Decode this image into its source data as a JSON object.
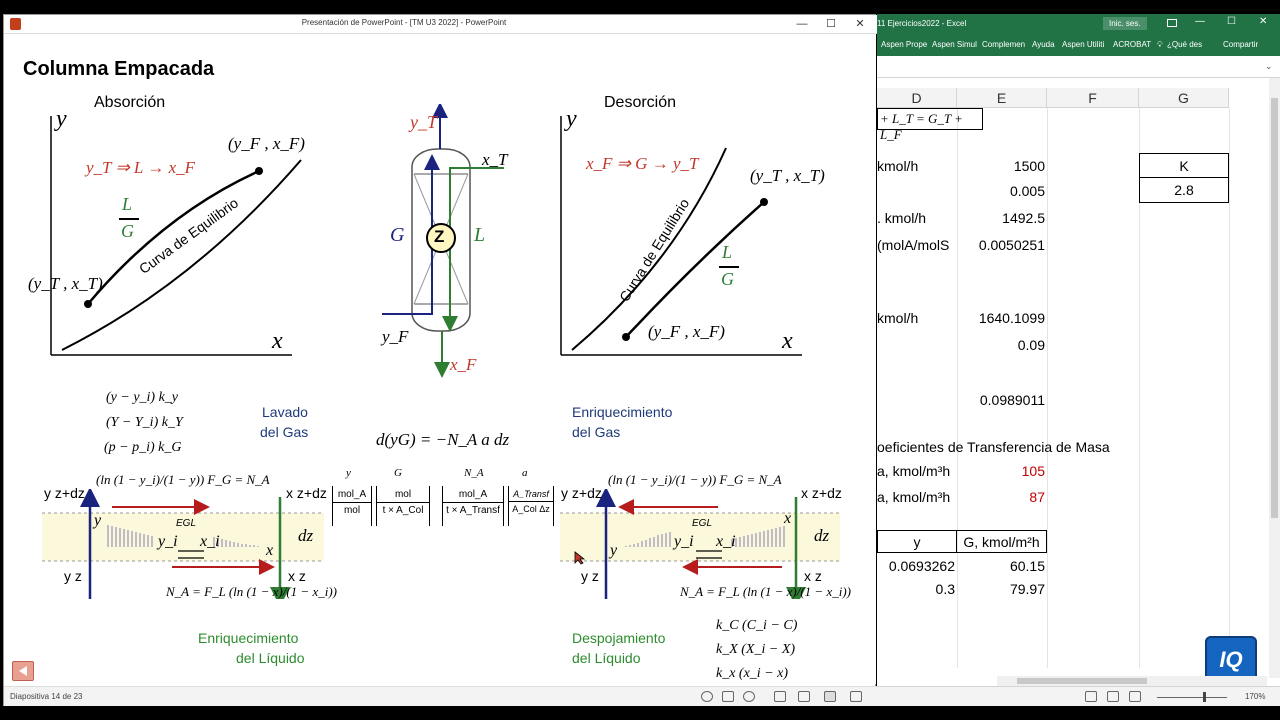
{
  "ppt": {
    "window_title": "Presentación de PowerPoint - [TM U3 2022] - PowerPoint",
    "status_left": "Diapositiva 14 de 23",
    "zoom": "",
    "slide": {
      "title": "Columna Empacada",
      "absorcion": {
        "heading": "Absorción",
        "y_axis": "y",
        "x_axis": "x",
        "flow_eq": "y_T ⇒ L → x_F",
        "top_point": "(y_F , x_F)",
        "bottom_point": "(y_T , x_T)",
        "curve_label": "Curva de Equilibrio",
        "slope_num": "L",
        "slope_den": "G"
      },
      "column": {
        "yT": "y_T",
        "xT": "x_T",
        "G": "G",
        "Z": "Z",
        "L": "L",
        "yF": "y_F",
        "xF": "x_F"
      },
      "desorcion": {
        "heading": "Desorción",
        "y_axis": "y",
        "x_axis": "x",
        "flow_eq": "x_F ⇒ G → y_T",
        "top_point": "(y_T , x_T)",
        "bottom_point": "(y_F , x_F)",
        "curve_label": "Curva de Equilibrio",
        "slope_num": "L",
        "slope_den": "G"
      },
      "left_lower": {
        "driving_forces": [
          "(y − y_i) k_y",
          "(Y − Y_i) k_Y",
          "(p − p_i) k_G"
        ],
        "title_line1": "Lavado",
        "title_line2": "del Gas",
        "flux_gas": "(ln (1 − y_i)/(1 − y)) F_G = N_A",
        "y_top": "y z+dz",
        "y_bottom": "y z",
        "x_top": "x z+dz",
        "x_bottom": "x z",
        "dz": "dz",
        "y": "y",
        "yi": "y_i",
        "xi": "x_i",
        "x": "x",
        "egl": "EGL",
        "flux_liq": "N_A = F_L (ln (1 − x)/(1 − x_i))",
        "footer_line1": "Enriquecimiento",
        "footer_line2": "del Líquido"
      },
      "middle": {
        "balance": "d(yG) = −N_A a dz",
        "col_y": "y",
        "col_G": "G",
        "col_NA": "N_A",
        "col_a": "a",
        "u1_num": "mol_A",
        "u1_den": "mol",
        "u2_num": "mol",
        "u2_den": "t × A_Col",
        "u3_num": "mol_A",
        "u3_den": "t × A_Transf",
        "u4_num": "A_Transf",
        "u4_den": "A_Col Δz"
      },
      "right_lower": {
        "title_line1": "Enriquecimiento",
        "title_line2": "del Gas",
        "flux_gas": "(ln (1 − y_i)/(1 − y)) F_G = N_A",
        "y_top": "y z+dz",
        "y_bottom": "y z",
        "x_top": "x z+dz",
        "x_bottom": "x z",
        "dz": "dz",
        "y": "y",
        "yi": "y_i",
        "xi": "x_i",
        "x": "x",
        "egl": "EGL",
        "flux_liq": "N_A = F_L (ln (1 − x)/(1 − x_i))",
        "footer_line1": "Despojamiento",
        "footer_line2": "del Líquido",
        "driving_forces": [
          "k_C (C_i − C)",
          "k_X (X_i − X)",
          "k_x (x_i − x)"
        ]
      }
    }
  },
  "excel": {
    "window_title": "11 Ejercicios2022 - Excel",
    "signin": "Inic. ses.",
    "ribbon_tabs": [
      "Aspen Prope",
      "Aspen Simul",
      "Complemen",
      "Ayuda",
      "Aspen Utiliti",
      "ACROBAT",
      "¿Qué des",
      "Compartir"
    ],
    "columns": [
      "D",
      "E",
      "F",
      "G"
    ],
    "cells": {
      "header_formula": "+ L_T = G_T + L_F",
      "r1_label": "kmol/h",
      "r1_val": "1500",
      "r2_val": "0.005",
      "r3_label": ". kmol/h",
      "r3_val": "1492.5",
      "r4_label": "(molA/molS",
      "r4_val": "0.0050251",
      "r5_label": "kmol/h",
      "r5_val": "1640.1099",
      "r6_val": "0.09",
      "r7_val": "0.0989011",
      "k_label": "K",
      "k_val": "2.8",
      "section": "oeficientes de Transferencia de Masa",
      "s1_label": "a, kmol/m³h",
      "s1_val": "105",
      "s2_label": "a, kmol/m³h",
      "s2_val": "87",
      "t_h1": "y",
      "t_h2": "G, kmol/m²h",
      "t_r1_a": "0.0693262",
      "t_r1_b": "60.15",
      "t_r2_a": "0.3",
      "t_r2_b": "79.97"
    },
    "zoom": "170%",
    "logo": "IQ"
  },
  "colors": {
    "excel_green": "#217346",
    "red_var": "#c0392b",
    "navy": "#1a237e",
    "green_var": "#2e7d32",
    "excel_red_val": "#c00000"
  }
}
